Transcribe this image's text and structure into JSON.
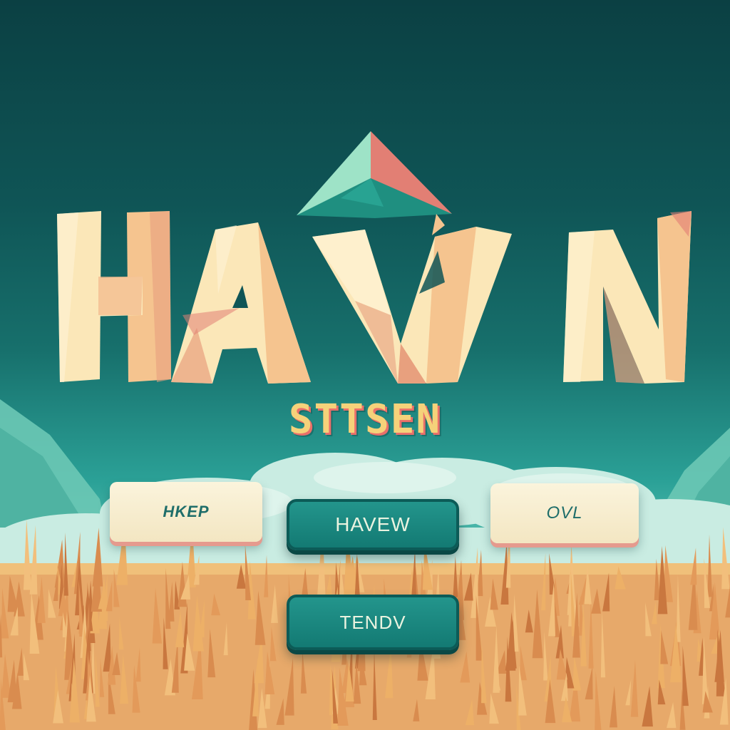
{
  "title": {
    "letters": [
      "H",
      "A",
      "V",
      "N"
    ],
    "colors": {
      "letter_light": "#fbe7b8",
      "letter_mid": "#f5c48f",
      "letter_shade": "#e8a07e",
      "letter_edge": "#d67b74"
    }
  },
  "emblem": {
    "icon": "crystal-pyramid-icon",
    "colors": {
      "left": "#9ee3c7",
      "right": "#e27f74",
      "front": "#1f8f80"
    }
  },
  "subtitle": "STTSEN",
  "menu": {
    "left_button": "HKEP",
    "center_button": "HAVEW",
    "right_button": "OVL",
    "bottom_button": "TENDV"
  },
  "palette": {
    "sky_top": "#0b4043",
    "sky_bottom": "#59c2b3",
    "hills": "#6cc8b5",
    "clouds": "#c9ece2",
    "field": "#e7a96a",
    "field_dark": "#c9773f",
    "button_light": "#fbf4dc",
    "button_teal": "#168077"
  }
}
